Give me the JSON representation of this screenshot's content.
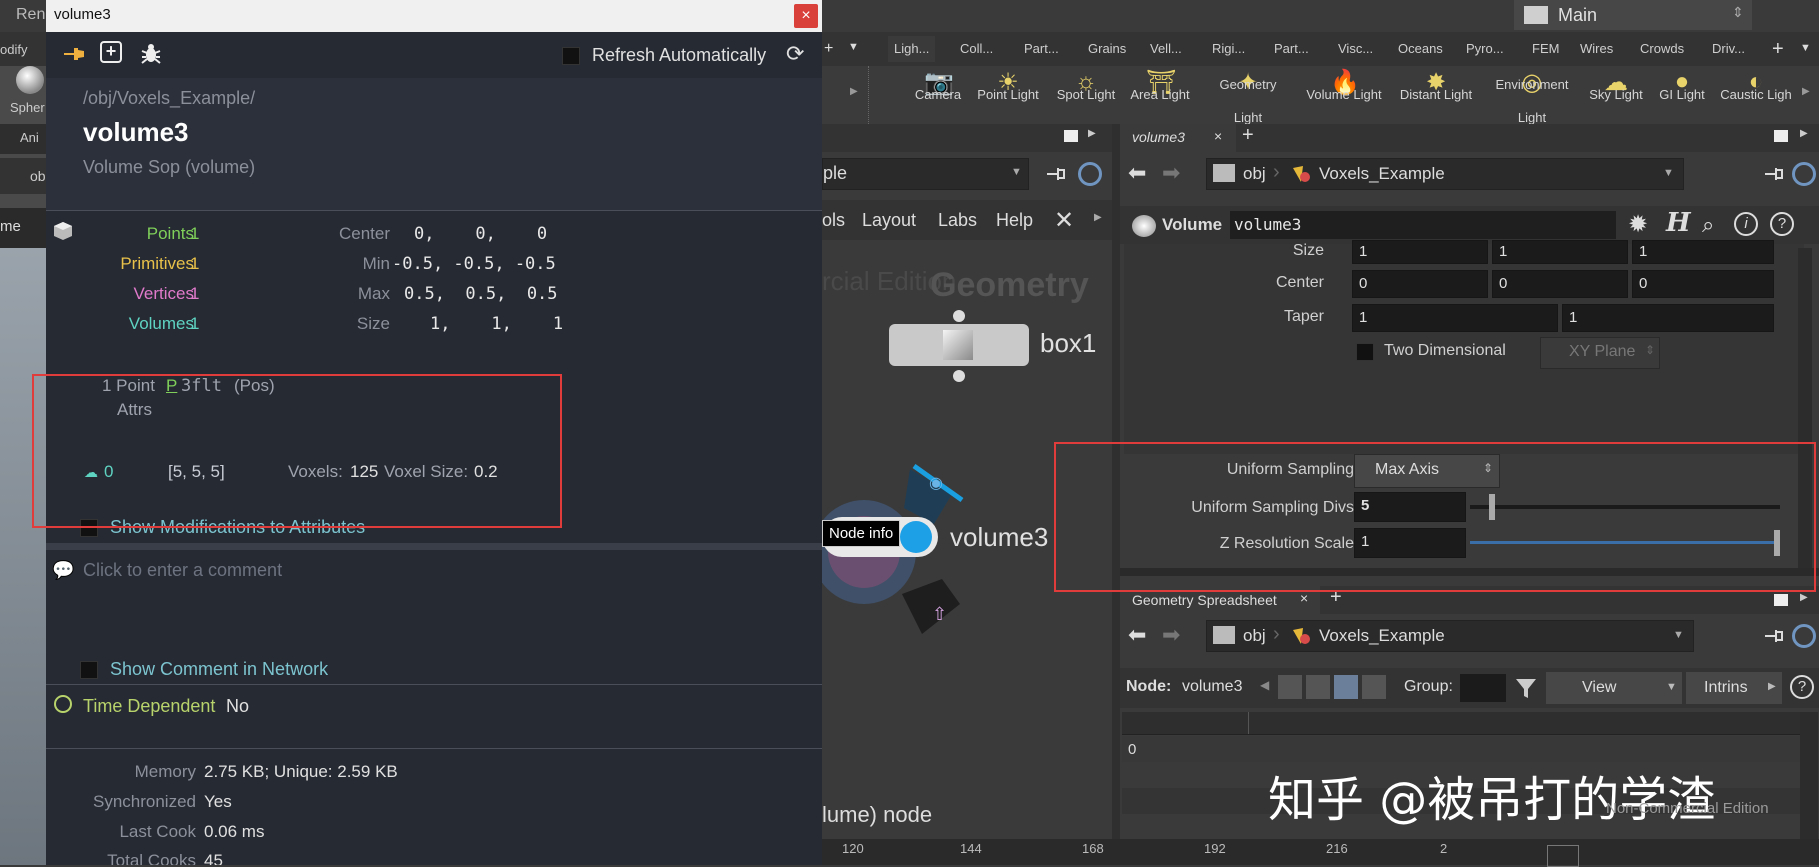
{
  "bg": {
    "left_fragments": [
      "Ren",
      "odify",
      "Spher",
      "Ani",
      "ob",
      "me",
      "R"
    ]
  },
  "popup": {
    "title": "volume3",
    "close_glyph": "×",
    "refresh_auto_label": "Refresh Automatically",
    "path": "/obj/Voxels_Example/",
    "node_name": "volume3",
    "node_type": "Volume Sop (volume)",
    "stats": {
      "points_label": "Points",
      "points_value": "1",
      "primitives_label": "Primitives",
      "primitives_value": "1",
      "vertices_label": "Vertices",
      "vertices_value": "1",
      "volumes_label": "Volumes",
      "volumes_value": "1",
      "center_label": "Center",
      "center_value": "0,    0,    0",
      "min_label": "Min",
      "min_value": "-0.5, -0.5, -0.5",
      "max_label": "Max",
      "max_value": "0.5,  0.5,  0.5",
      "size_label": "Size",
      "size_value": "1,    1,    1"
    },
    "attrs": {
      "count_label": "1 Point",
      "attrs_label": "Attrs",
      "attr_name": "P",
      "attr_type": "3flt",
      "attr_qual": "(Pos)",
      "vol_index": "0",
      "vol_res": "[5, 5, 5]",
      "voxels_label": "Voxels:",
      "voxels_value": "125",
      "voxel_size_label": "Voxel Size:",
      "voxel_size_value": "0.2"
    },
    "show_mods_label": "Show Modifications to Attributes",
    "comment_placeholder": "Click to enter a comment",
    "show_comment_label": "Show Comment in Network",
    "time_dependent_label": "Time Dependent",
    "time_dependent_value": "No",
    "memory_label": "Memory",
    "memory_value": "2.75 KB; Unique: 2.59 KB",
    "synchronized_label": "Synchronized",
    "synchronized_value": "Yes",
    "last_cook_label": "Last Cook",
    "last_cook_value": "0.06 ms",
    "total_cooks_label": "Total Cooks",
    "total_cooks_value": "45"
  },
  "desktop": {
    "main_label": "Main"
  },
  "shelf": {
    "tabs": [
      "Ligh...",
      "Coll...",
      "Part...",
      "Grains",
      "Vell...",
      "Rigi...",
      "Part...",
      "Visc...",
      "Oceans",
      "Pyro...",
      "FEM",
      "Wires",
      "Crowds",
      "Driv..."
    ],
    "tools": [
      {
        "label": "Camera",
        "label2": ""
      },
      {
        "label": "Point Light",
        "label2": ""
      },
      {
        "label": "Spot Light",
        "label2": ""
      },
      {
        "label": "Area Light",
        "label2": ""
      },
      {
        "label": "Geometry",
        "label2": "Light"
      },
      {
        "label": "Volume Light",
        "label2": ""
      },
      {
        "label": "Distant Light",
        "label2": ""
      },
      {
        "label": "Environment",
        "label2": "Light"
      },
      {
        "label": "Sky Light",
        "label2": ""
      },
      {
        "label": "GI Light",
        "label2": ""
      },
      {
        "label": "Caustic Ligh",
        "label2": ""
      }
    ]
  },
  "network": {
    "path_fragment": "ple",
    "menu": {
      "tools": "ols",
      "layout": "Layout",
      "labs": "Labs",
      "help": "Help"
    },
    "watermark_edition": "rcial Edition",
    "watermark_context": "Geometry",
    "box_node": "box1",
    "volume_node": "volume3",
    "tooltip": "Node info",
    "status_text": "lume) node",
    "timeline_ticks": [
      "120",
      "144",
      "168",
      "192",
      "216",
      "2"
    ]
  },
  "params": {
    "tab_label": "volume3",
    "path_obj": "obj",
    "path_net": "Voxels_Example",
    "node_type": "Volume",
    "node_name": "volume3",
    "size_label": "Size",
    "size_vals": [
      "1",
      "1",
      "1"
    ],
    "center_label": "Center",
    "center_vals": [
      "0",
      "0",
      "0"
    ],
    "taper_label": "Taper",
    "taper_vals": [
      "1",
      "1"
    ],
    "two_dim_label": "Two Dimensional",
    "plane_label": "XY Plane",
    "uniform_sampling_label": "Uniform Sampling",
    "uniform_sampling_value": "Max Axis",
    "uniform_divs_label": "Uniform Sampling Divs",
    "uniform_divs_value": "5",
    "uniform_divs_slider_fraction": 0.06,
    "z_res_label": "Z Resolution Scale",
    "z_res_value": "1",
    "z_res_slider_fraction": 1.0
  },
  "spreadsheet": {
    "tab_label": "Geometry Spreadsheet",
    "path_obj": "obj",
    "path_net": "Voxels_Example",
    "node_label": "Node:",
    "node_value": "volume3",
    "group_label": "Group:",
    "view_label": "View",
    "intrinsics_label": "Intrins",
    "row_index": "0",
    "watermark_user": "知乎 @被吊打的学渣",
    "watermark_edition": "Non-Commercial Edition"
  },
  "colors": {
    "points": "#7fcf5a",
    "primitives": "#e8c14a",
    "vertices": "#e07acb",
    "volumes": "#5fd3c2",
    "highlight_box": "#e03c3c"
  }
}
